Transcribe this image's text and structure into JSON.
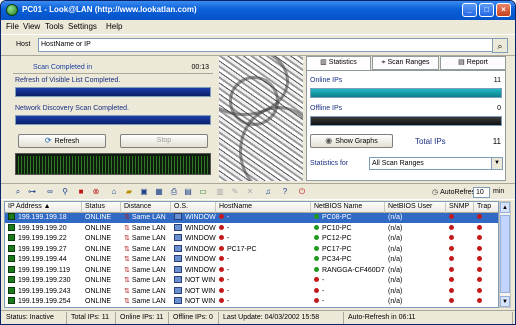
{
  "window": {
    "title": "PC01 - Look@LAN (http://www.lookatlan.com)"
  },
  "menu": [
    "File",
    "View",
    "Tools",
    "Settings",
    "Help"
  ],
  "host": {
    "label": "Host",
    "value": "HostName or IP"
  },
  "scan": {
    "completed_label": "Scan Completed in",
    "time": "00:13",
    "refresh_msg": "Refresh of Visible List Completed.",
    "discovery_msg": "Network Discovery Scan Completed.",
    "refresh_button": "Refresh",
    "stop_button": "Stop"
  },
  "tabs": [
    {
      "label": "Statistics",
      "icon": "statistics-icon",
      "active": true
    },
    {
      "label": "Scan Ranges",
      "icon": "scan-ranges-icon",
      "active": false
    },
    {
      "label": "Report",
      "icon": "report-icon",
      "active": false
    }
  ],
  "stats": {
    "online_label": "Online IPs",
    "online_value": "11",
    "offline_label": "Offline IPs",
    "offline_value": "0",
    "show_graphs": "Show Graphs",
    "total_label": "Total IPs",
    "total_value": "11",
    "stats_for_label": "Statistics for",
    "stats_for_value": "All Scan Ranges"
  },
  "toolbar": {
    "autorefresh_label": "AutoRefresh",
    "minutes": "10",
    "min_label": "min"
  },
  "columns": [
    "IP Address",
    "Status",
    "Distance",
    "O.S.",
    "HostName",
    "NetBIOS Name",
    "NetBIOS User",
    "SNMP",
    "Trap"
  ],
  "rows": [
    {
      "ip": "199.199.199.18",
      "status": "ONLINE",
      "distance": "Same LAN",
      "os": "WINDOWS",
      "host": "-",
      "netbios": "PC08-PC",
      "user": "(n/a)",
      "snmp": "",
      "trap": "",
      "selected": true
    },
    {
      "ip": "199.199.199.20",
      "status": "ONLINE",
      "distance": "Same LAN",
      "os": "WINDOWS",
      "host": "-",
      "netbios": "PC10-PC",
      "user": "(n/a)",
      "snmp": "",
      "trap": "",
      "selected": false
    },
    {
      "ip": "199.199.199.22",
      "status": "ONLINE",
      "distance": "Same LAN",
      "os": "WINDOWS",
      "host": "-",
      "netbios": "PC12-PC",
      "user": "(n/a)",
      "snmp": "",
      "trap": "",
      "selected": false
    },
    {
      "ip": "199.199.199.27",
      "status": "ONLINE",
      "distance": "Same LAN",
      "os": "WINDOWS",
      "host": "PC17-PC",
      "netbios": "PC17-PC",
      "user": "(n/a)",
      "snmp": "",
      "trap": "",
      "selected": false
    },
    {
      "ip": "199.199.199.44",
      "status": "ONLINE",
      "distance": "Same LAN",
      "os": "WINDOWS",
      "host": "-",
      "netbios": "PC34-PC",
      "user": "(n/a)",
      "snmp": "",
      "trap": "",
      "selected": false
    },
    {
      "ip": "199.199.199.119",
      "status": "ONLINE",
      "distance": "Same LAN",
      "os": "WINDOWS",
      "host": "-",
      "netbios": "RANGGA-CF460D7",
      "user": "(n/a)",
      "snmp": "",
      "trap": "",
      "selected": false
    },
    {
      "ip": "199.199.199.230",
      "status": "ONLINE",
      "distance": "Same LAN",
      "os": "NOT WIN",
      "host": "-",
      "netbios": "-",
      "user": "(n/a)",
      "snmp": "",
      "trap": "",
      "selected": false
    },
    {
      "ip": "199.199.199.243",
      "status": "ONLINE",
      "distance": "Same LAN",
      "os": "NOT WIN",
      "host": "-",
      "netbios": "-",
      "user": "(n/a)",
      "snmp": "",
      "trap": "",
      "selected": false
    },
    {
      "ip": "199.199.199.254",
      "status": "ONLINE",
      "distance": "Same LAN",
      "os": "NOT WIN",
      "host": "-",
      "netbios": "-",
      "user": "(n/a)",
      "snmp": "",
      "trap": "",
      "selected": false
    }
  ],
  "status": {
    "state": "Status: Inactive",
    "total": "Total IPs: 11",
    "online": "Online IPs: 11",
    "offline": "Offline IPs: 0",
    "last_update": "Last Update: 04/03/2002 15:58",
    "autorefresh": "Auto-Refresh in 06:11"
  },
  "colors": {
    "title_blue": "#0553c8",
    "selection": "#316ac5",
    "online_bar": "#0c7f8c",
    "status_red": "#c21a1a"
  }
}
